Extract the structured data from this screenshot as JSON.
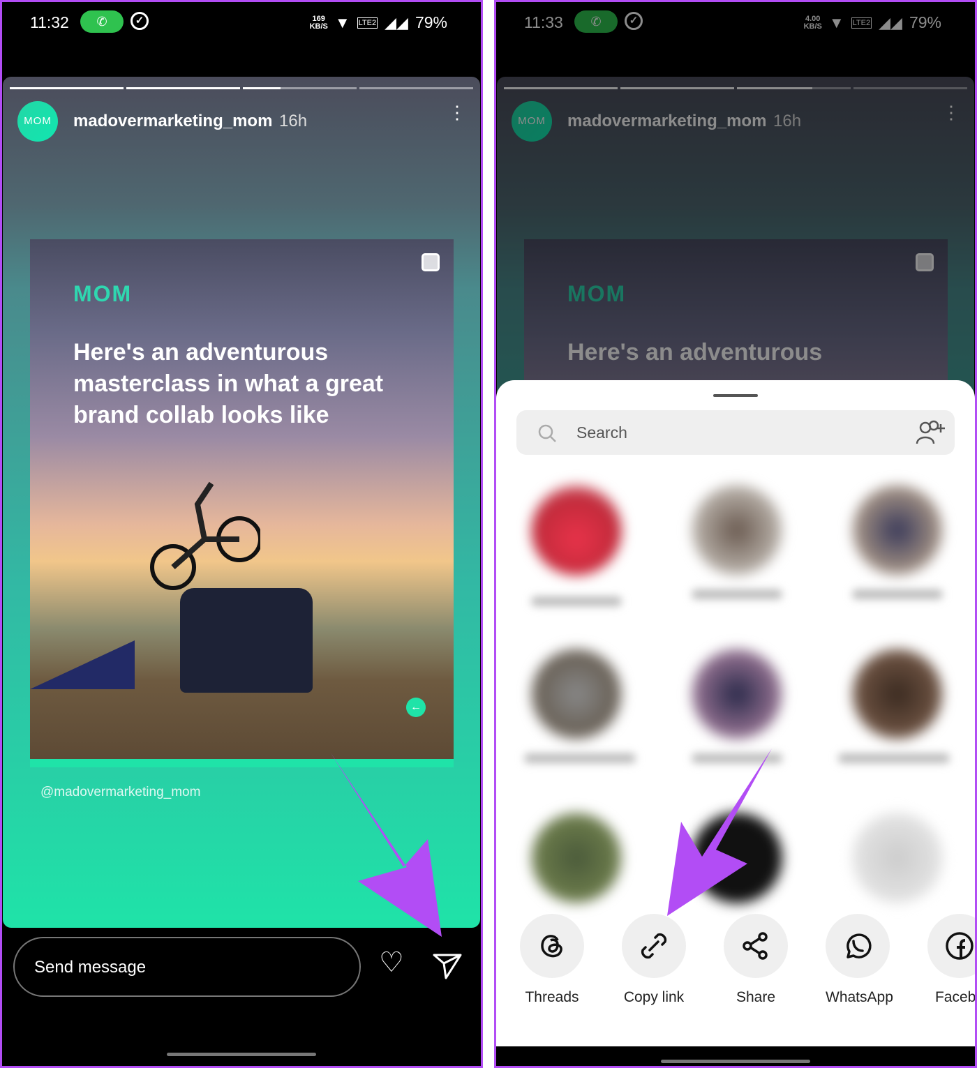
{
  "left": {
    "status": {
      "time": "11:32",
      "speed_value": "169",
      "speed_unit": "KB/S",
      "battery": "79%"
    },
    "story": {
      "progress": [
        1,
        1,
        0.33,
        0
      ],
      "username": "madovermarketing_mom",
      "time_ago": "16h",
      "post": {
        "logo": "MOM",
        "headline": "Here's an adventurous masterclass in what a great brand collab looks like"
      },
      "mention": "@madovermarketing_mom"
    },
    "reply": {
      "placeholder": "Send message"
    }
  },
  "right": {
    "status": {
      "time": "11:33",
      "speed_value": "4.00",
      "speed_unit": "KB/S",
      "battery": "79%"
    },
    "story": {
      "username": "madovermarketing_mom",
      "time_ago": "16h",
      "post": {
        "logo": "MOM",
        "headline": "Here's an adventurous"
      }
    },
    "sheet": {
      "search_placeholder": "Search",
      "share_options": [
        {
          "label": "Threads",
          "icon": "threads-icon"
        },
        {
          "label": "Copy link",
          "icon": "link-icon"
        },
        {
          "label": "Share",
          "icon": "share-icon"
        },
        {
          "label": "WhatsApp",
          "icon": "whatsapp-icon"
        },
        {
          "label": "Facebo",
          "icon": "facebook-icon"
        }
      ]
    }
  },
  "colors": {
    "accent_arrow": "#b24df5",
    "brand": "#1fe3a8",
    "call": "#2fc24f"
  }
}
